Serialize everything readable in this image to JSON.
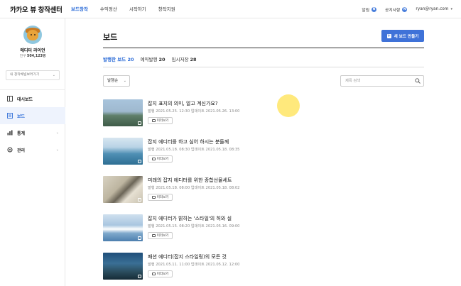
{
  "app": {
    "brand": "카카오 뷰 창작센터"
  },
  "nav": {
    "items": [
      "보드창작",
      "수익정산",
      "시작하기",
      "창작지원"
    ],
    "active_index": 0
  },
  "top_right": {
    "notice_label": "알림",
    "notice_badge": "N",
    "announce_label": "공지사항",
    "announce_badge": "N",
    "user_email": "ryan@ryan.com"
  },
  "sidebar": {
    "profile_name": "에디터 라이언",
    "subscribers_label": "친구",
    "subscribers_count": "504,123명",
    "channel_select": "내 창작채널보러가기",
    "menu": [
      {
        "label": "대시보드",
        "icon": "dashboard-icon",
        "has_chevron": false,
        "active": false
      },
      {
        "label": "보드",
        "icon": "board-icon",
        "has_chevron": false,
        "active": true
      },
      {
        "label": "통계",
        "icon": "stats-icon",
        "has_chevron": true,
        "active": false
      },
      {
        "label": "관리",
        "icon": "settings-icon",
        "has_chevron": true,
        "active": false
      }
    ]
  },
  "main": {
    "title": "보드",
    "new_board_button": "새 보드 만들기",
    "tabs": [
      {
        "label": "발행한 보드",
        "count": "20"
      },
      {
        "label": "예약발행",
        "count": "20"
      },
      {
        "label": "임시저장",
        "count": "28"
      }
    ],
    "active_tab": 0,
    "sort_select": "발행순",
    "search_placeholder": "제목 검색",
    "preview_label": "미리보기",
    "posts": [
      {
        "title": "잡지 표지의 의미, 알고 계신가요?",
        "meta": "발행 2021.05.25. 12:30   업데이트 2021.05.26. 13:00"
      },
      {
        "title": "잡지 에디터를 하고 싶어 하시는 분들께",
        "meta": "발행 2021.05.18. 08:30   업데이트 2021.05.18. 08:35"
      },
      {
        "title": "미래의 잡지 에디터를 위한 종합선물세트",
        "meta": "발행 2021.05.18. 08:00   업데이트 2021.05.18. 08:02"
      },
      {
        "title": "잡지 에디터가 밝히는 '스타일'의 허와 실",
        "meta": "발행 2021.05.15. 08:20   업데이트 2021.05.16. 09:00"
      },
      {
        "title": "패션 에디터(잡지 스타일링)의 모든 것",
        "meta": "발행 2021.05.11. 11:00   업데이트 2021.05.12. 12:00"
      }
    ]
  },
  "colors": {
    "accent": "#3f72d8",
    "active_bg": "#eef3fd",
    "cursor_highlight": "#ffe250"
  }
}
